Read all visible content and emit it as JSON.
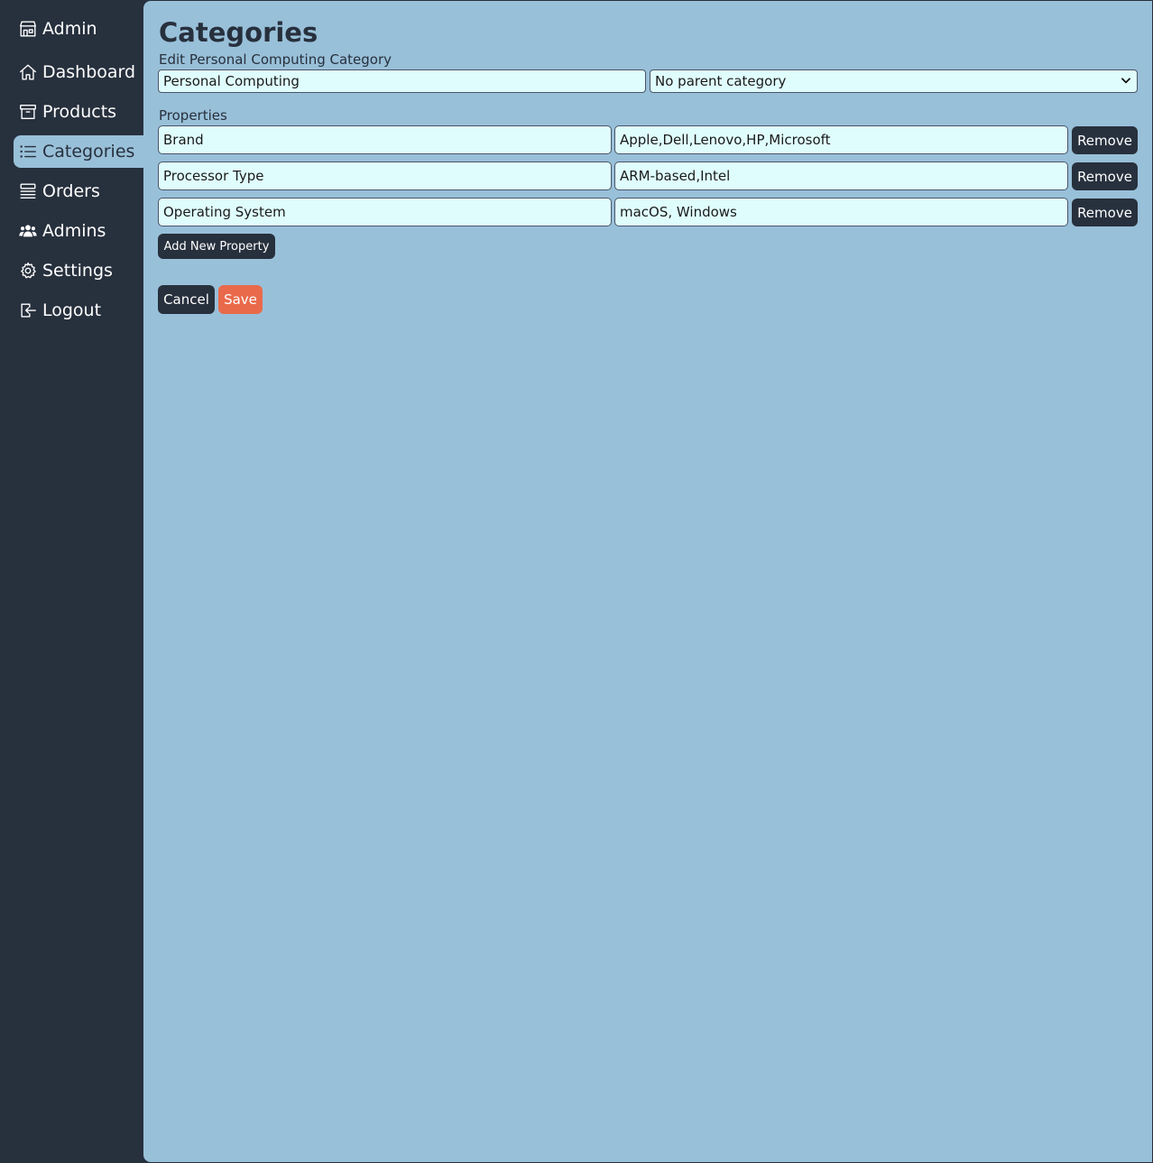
{
  "sidebar": {
    "brand": {
      "label": "Admin",
      "icon": "store-icon"
    },
    "items": [
      {
        "label": "Dashboard",
        "icon": "home-icon",
        "active": false
      },
      {
        "label": "Products",
        "icon": "archive-box-icon",
        "active": false
      },
      {
        "label": "Categories",
        "icon": "list-icon",
        "active": true
      },
      {
        "label": "Orders",
        "icon": "queue-list-icon",
        "active": false
      },
      {
        "label": "Admins",
        "icon": "users-icon",
        "active": false
      },
      {
        "label": "Settings",
        "icon": "gear-icon",
        "active": false
      },
      {
        "label": "Logout",
        "icon": "logout-icon",
        "active": false
      }
    ]
  },
  "main": {
    "title": "Categories",
    "edit_label": "Edit Personal Computing Category",
    "category_name": "Personal Computing",
    "parent_select": {
      "selected": "No parent category"
    },
    "properties_label": "Properties",
    "properties": [
      {
        "name": "Brand",
        "values": "Apple,Dell,Lenovo,HP,Microsoft",
        "remove_label": "Remove"
      },
      {
        "name": "Processor Type",
        "values": "ARM-based,Intel",
        "remove_label": "Remove"
      },
      {
        "name": "Operating System",
        "values": "macOS, Windows",
        "remove_label": "Remove"
      }
    ],
    "add_property_label": "Add New Property",
    "cancel_label": "Cancel",
    "save_label": "Save"
  },
  "colors": {
    "sidebar_bg": "#27303d",
    "main_bg": "#99c0d9",
    "input_bg": "#e0fdfd",
    "save_button": "#e96a4b",
    "dark_button": "#27303d"
  }
}
